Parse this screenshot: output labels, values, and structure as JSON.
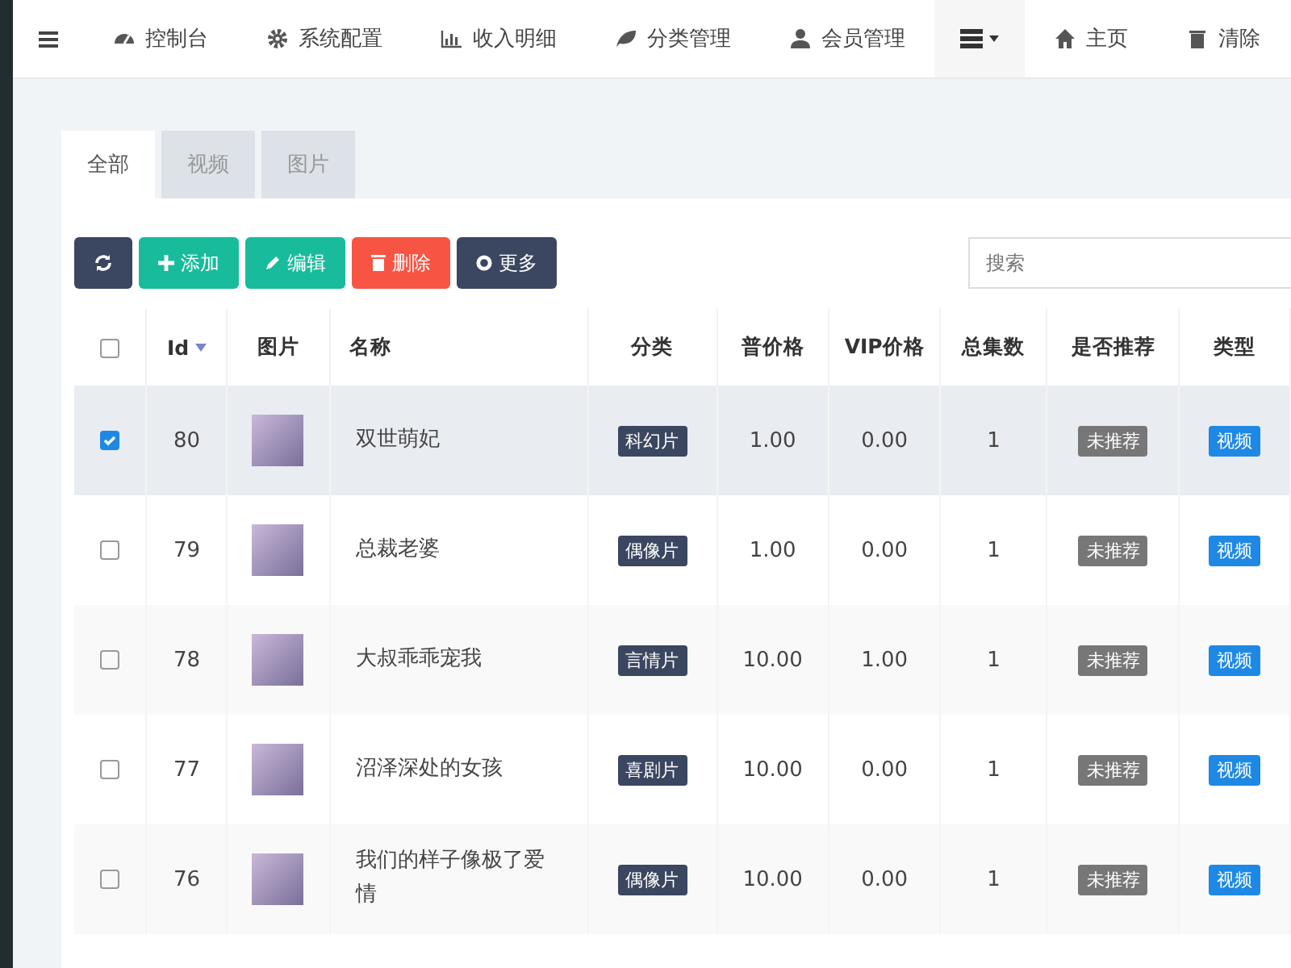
{
  "nav": {
    "items": [
      {
        "label": "控制台",
        "kind": "dashboard"
      },
      {
        "label": "系统配置",
        "kind": "gear"
      },
      {
        "label": "收入明细",
        "kind": "chart"
      },
      {
        "label": "分类管理",
        "kind": "leaf"
      },
      {
        "label": "会员管理",
        "kind": "user"
      }
    ],
    "right_items": [
      {
        "label": "主页",
        "kind": "home"
      },
      {
        "label": "清除",
        "kind": "trash"
      }
    ]
  },
  "tabs": [
    {
      "label": "全部",
      "selected": true
    },
    {
      "label": "视频",
      "selected": false
    },
    {
      "label": "图片",
      "selected": false
    }
  ],
  "toolbar": {
    "buttons": [
      {
        "kind": "refresh"
      },
      {
        "kind": "add",
        "label": "添加"
      },
      {
        "kind": "edit",
        "label": "编辑"
      },
      {
        "kind": "delete",
        "label": "删除"
      },
      {
        "kind": "more",
        "label": "更多"
      }
    ],
    "search": {
      "placeholder": "搜索"
    }
  },
  "table": {
    "all_checked": false,
    "columns": [
      "Id",
      "图片",
      "名称",
      "分类",
      "普价格",
      "VIP价格",
      "总集数",
      "是否推荐",
      "类型"
    ],
    "rows": [
      {
        "checked": true,
        "id": "80",
        "name": "双世萌妃",
        "category": "科幻片",
        "price": "1.00",
        "vip_price": "0.00",
        "episodes": "1",
        "recommend": "未推荐",
        "type": "视频"
      },
      {
        "checked": false,
        "id": "79",
        "name": "总裁老婆",
        "category": "偶像片",
        "price": "1.00",
        "vip_price": "0.00",
        "episodes": "1",
        "recommend": "未推荐",
        "type": "视频"
      },
      {
        "checked": false,
        "id": "78",
        "name": "大叔乖乖宠我",
        "category": "言情片",
        "price": "10.00",
        "vip_price": "1.00",
        "episodes": "1",
        "recommend": "未推荐",
        "type": "视频"
      },
      {
        "checked": false,
        "id": "77",
        "name": "沼泽深处的女孩",
        "category": "喜剧片",
        "price": "10.00",
        "vip_price": "0.00",
        "episodes": "1",
        "recommend": "未推荐",
        "type": "视频"
      },
      {
        "checked": false,
        "id": "76",
        "name": "我们的样子像极了爱情",
        "category": "偶像片",
        "price": "10.00",
        "vip_price": "0.00",
        "episodes": "1",
        "recommend": "未推荐",
        "type": "视频"
      }
    ]
  }
}
